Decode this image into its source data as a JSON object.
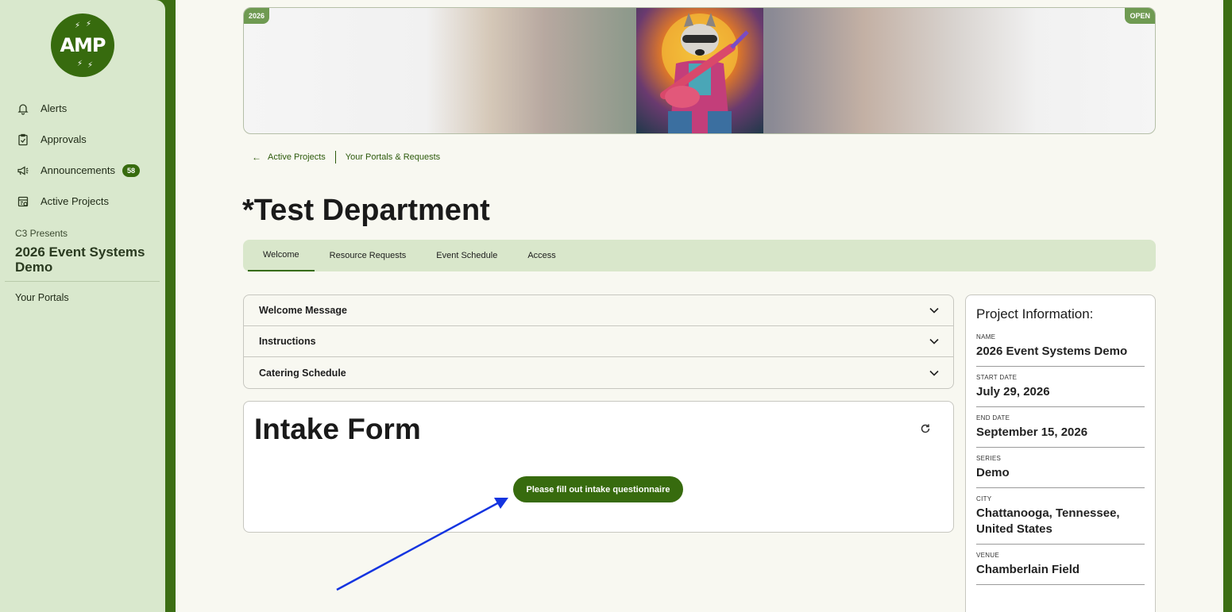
{
  "sidebar": {
    "logo_text": "AMP",
    "nav": [
      {
        "label": "Alerts",
        "icon": "bell-icon"
      },
      {
        "label": "Approvals",
        "icon": "clipboard-check-icon"
      },
      {
        "label": "Announcements",
        "icon": "megaphone-icon",
        "badge": "58"
      },
      {
        "label": "Active Projects",
        "icon": "project-list-icon"
      }
    ],
    "presents": "C3 Presents",
    "project_name": "2026 Event Systems Demo",
    "portals_link": "Your Portals"
  },
  "banner": {
    "year_tag": "2026",
    "status_tag": "OPEN"
  },
  "breadcrumbs": {
    "back": "Active Projects",
    "current": "Your Portals & Requests"
  },
  "page": {
    "title": "*Test Department"
  },
  "tabs": [
    {
      "label": "Welcome",
      "active": true
    },
    {
      "label": "Resource Requests"
    },
    {
      "label": "Event Schedule"
    },
    {
      "label": "Access"
    }
  ],
  "accordion": [
    {
      "label": "Welcome Message"
    },
    {
      "label": "Instructions"
    },
    {
      "label": "Catering Schedule"
    }
  ],
  "intake": {
    "title": "Intake Form",
    "button_label": "Please fill out intake questionnaire"
  },
  "project_info": {
    "title": "Project Information:",
    "fields": [
      {
        "label": "NAME",
        "value": "2026 Event Systems Demo"
      },
      {
        "label": "START DATE",
        "value": "July 29, 2026"
      },
      {
        "label": "END DATE",
        "value": "September 15, 2026"
      },
      {
        "label": "SERIES",
        "value": "Demo"
      },
      {
        "label": "CITY",
        "value": "Chattanooga, Tennessee, United States"
      },
      {
        "label": "VENUE",
        "value": "Chamberlain Field"
      }
    ]
  },
  "colors": {
    "brand_green": "#376b0e",
    "frame_green": "#3c6e14",
    "sidebar_bg": "#d9e8cd",
    "annotation_arrow": "#1434e0"
  }
}
